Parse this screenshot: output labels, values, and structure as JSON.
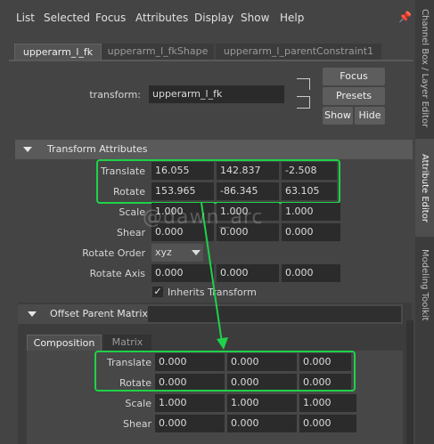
{
  "menu": {
    "items": [
      "List",
      "Selected",
      "Focus",
      "Attributes",
      "Display",
      "Show",
      "Help"
    ],
    "pin_icon": "pin-icon"
  },
  "tabs": [
    {
      "label": "upperarm_l_fk",
      "active": true
    },
    {
      "label": "upperarm_l_fkShape",
      "active": false
    },
    {
      "label": "upperarm_l_parentConstraint1",
      "active": false
    }
  ],
  "node": {
    "type_label": "transform:",
    "name_value": "upperarm_l_fk",
    "buttons": {
      "focus": "Focus",
      "presets": "Presets",
      "show": "Show",
      "hide": "Hide"
    }
  },
  "transform_section": {
    "title": "Transform Attributes",
    "translate": {
      "label": "Translate",
      "values": [
        "16.055",
        "142.837",
        "-2.508"
      ]
    },
    "rotate": {
      "label": "Rotate",
      "values": [
        "153.965",
        "-86.345",
        "63.105"
      ]
    },
    "scale": {
      "label": "Scale",
      "values": [
        "1.000",
        "1.000",
        "1.000"
      ]
    },
    "shear": {
      "label": "Shear",
      "values": [
        "0.000",
        "0.000",
        "0.000"
      ]
    },
    "rotate_order": {
      "label": "Rotate Order",
      "value": "xyz"
    },
    "rotate_axis": {
      "label": "Rotate Axis",
      "values": [
        "0.000",
        "0.000",
        "0.000"
      ]
    },
    "inherits_transform": {
      "label": "Inherits Transform",
      "checked": true
    }
  },
  "offset_section": {
    "title": "Offset Parent Matrix",
    "tabs": [
      "Composition",
      "Matrix"
    ],
    "translate": {
      "label": "Translate",
      "values": [
        "0.000",
        "0.000",
        "0.000"
      ]
    },
    "rotate": {
      "label": "Rotate",
      "values": [
        "0.000",
        "0.000",
        "0.000"
      ]
    },
    "scale": {
      "label": "Scale",
      "values": [
        "1.000",
        "1.000",
        "1.000"
      ]
    },
    "shear": {
      "label": "Shear",
      "values": [
        "0.000",
        "0.000",
        "0.000"
      ]
    }
  },
  "side_tabs": [
    "Channel Box / Layer Editor",
    "Attribute Editor",
    "Modeling Toolkit"
  ],
  "watermark": "@dawn_arc",
  "colors": {
    "highlight": "#1fd149",
    "panel": "#444444",
    "field": "#2b2b2b"
  }
}
